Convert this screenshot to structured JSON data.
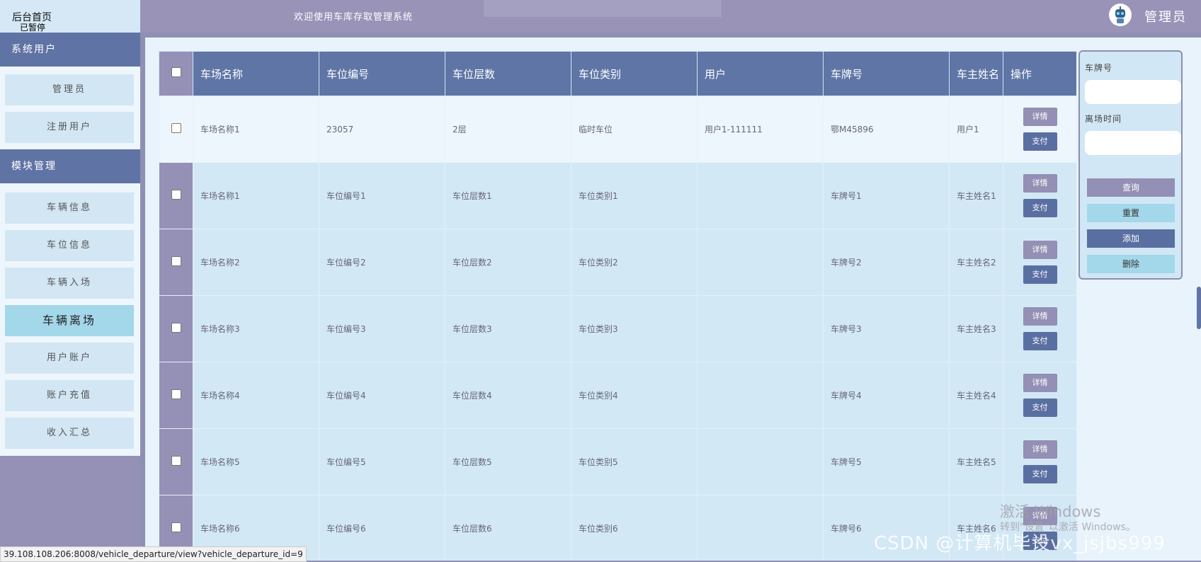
{
  "header": {
    "brand_title": "后台首页",
    "brand_sub": "已暂停",
    "welcome": "欢迎使用车库存取管理系统",
    "user": "管理员"
  },
  "sidebar": {
    "groups": [
      {
        "label": "系统用户",
        "items": [
          {
            "label": "管理员"
          },
          {
            "label": "注册用户"
          }
        ]
      },
      {
        "label": "模块管理",
        "items": [
          {
            "label": "车辆信息"
          },
          {
            "label": "车位信息"
          },
          {
            "label": "车辆入场"
          },
          {
            "label": "车辆离场",
            "active": true
          },
          {
            "label": "用户账户"
          },
          {
            "label": "账户充值"
          },
          {
            "label": "收入汇总"
          }
        ]
      }
    ]
  },
  "table": {
    "columns": [
      "车场名称",
      "车位编号",
      "车位层数",
      "车位类别",
      "用户",
      "车牌号",
      "车主姓名",
      "操作"
    ],
    "rows": [
      {
        "c0": "车场名称1",
        "c1": "23057",
        "c2": "2层",
        "c3": "临时车位",
        "c4": "用户1-111111",
        "c5": "鄂M45896",
        "c6": "用户1"
      },
      {
        "c0": "车场名称1",
        "c1": "车位编号1",
        "c2": "车位层数1",
        "c3": "车位类别1",
        "c4": "",
        "c5": "车牌号1",
        "c6": "车主姓名1"
      },
      {
        "c0": "车场名称2",
        "c1": "车位编号2",
        "c2": "车位层数2",
        "c3": "车位类别2",
        "c4": "",
        "c5": "车牌号2",
        "c6": "车主姓名2"
      },
      {
        "c0": "车场名称3",
        "c1": "车位编号3",
        "c2": "车位层数3",
        "c3": "车位类别3",
        "c4": "",
        "c5": "车牌号3",
        "c6": "车主姓名3"
      },
      {
        "c0": "车场名称4",
        "c1": "车位编号4",
        "c2": "车位层数4",
        "c3": "车位类别4",
        "c4": "",
        "c5": "车牌号4",
        "c6": "车主姓名4"
      },
      {
        "c0": "车场名称5",
        "c1": "车位编号5",
        "c2": "车位层数5",
        "c3": "车位类别5",
        "c4": "",
        "c5": "车牌号5",
        "c6": "车主姓名5"
      },
      {
        "c0": "车场名称6",
        "c1": "车位编号6",
        "c2": "车位层数6",
        "c3": "车位类别6",
        "c4": "",
        "c5": "车牌号6",
        "c6": "车主姓名6"
      }
    ],
    "detail_label": "详情",
    "pay_label": "支付"
  },
  "search": {
    "plate_label": "车牌号",
    "plate_value": "",
    "time_label": "离场时间",
    "time_value": "",
    "query": "查询",
    "reset": "重置",
    "add": "添加",
    "delete": "删除",
    "colors": {
      "query": "#948fb4",
      "reset": "#a3d7ea",
      "add": "#5a6fa1",
      "delete": "#a3d7ea"
    }
  },
  "status_url": "39.108.108.206:8008/vehicle_departure/view?vehicle_departure_id=9",
  "watermark": {
    "line1": "激活 Windows",
    "line2": "转到\"设置\"以激活 Windows。",
    "csdn": "CSDN @计算机毕设vx_jsjbs999"
  }
}
